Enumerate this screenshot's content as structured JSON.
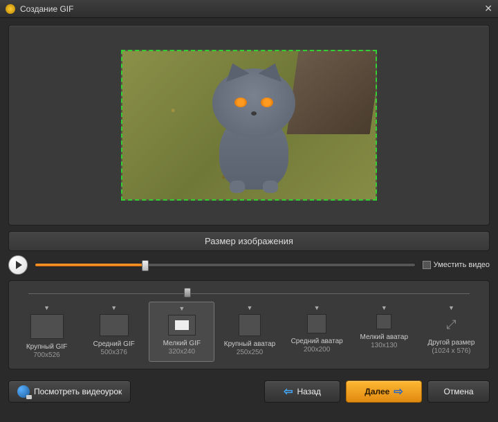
{
  "window": {
    "title": "Создание GIF"
  },
  "section_title": "Размер изображения",
  "fit_video_label": "Уместить видео",
  "slider_position_pct": 29,
  "presets": [
    {
      "label": "Крупный GIF",
      "dims": "700x526"
    },
    {
      "label": "Средний GIF",
      "dims": "500x376"
    },
    {
      "label": "Мелкий GIF",
      "dims": "320x240",
      "selected": true
    },
    {
      "label": "Крупный аватар",
      "dims": "250x250"
    },
    {
      "label": "Средний аватар",
      "dims": "200x200"
    },
    {
      "label": "Мелкий аватар",
      "dims": "130x130"
    },
    {
      "label": "Другой размер",
      "dims": "(1024 x 576)"
    }
  ],
  "buttons": {
    "watch_tutorial": "Посмотреть видеоурок",
    "back": "Назад",
    "next": "Далее",
    "cancel": "Отмена"
  }
}
